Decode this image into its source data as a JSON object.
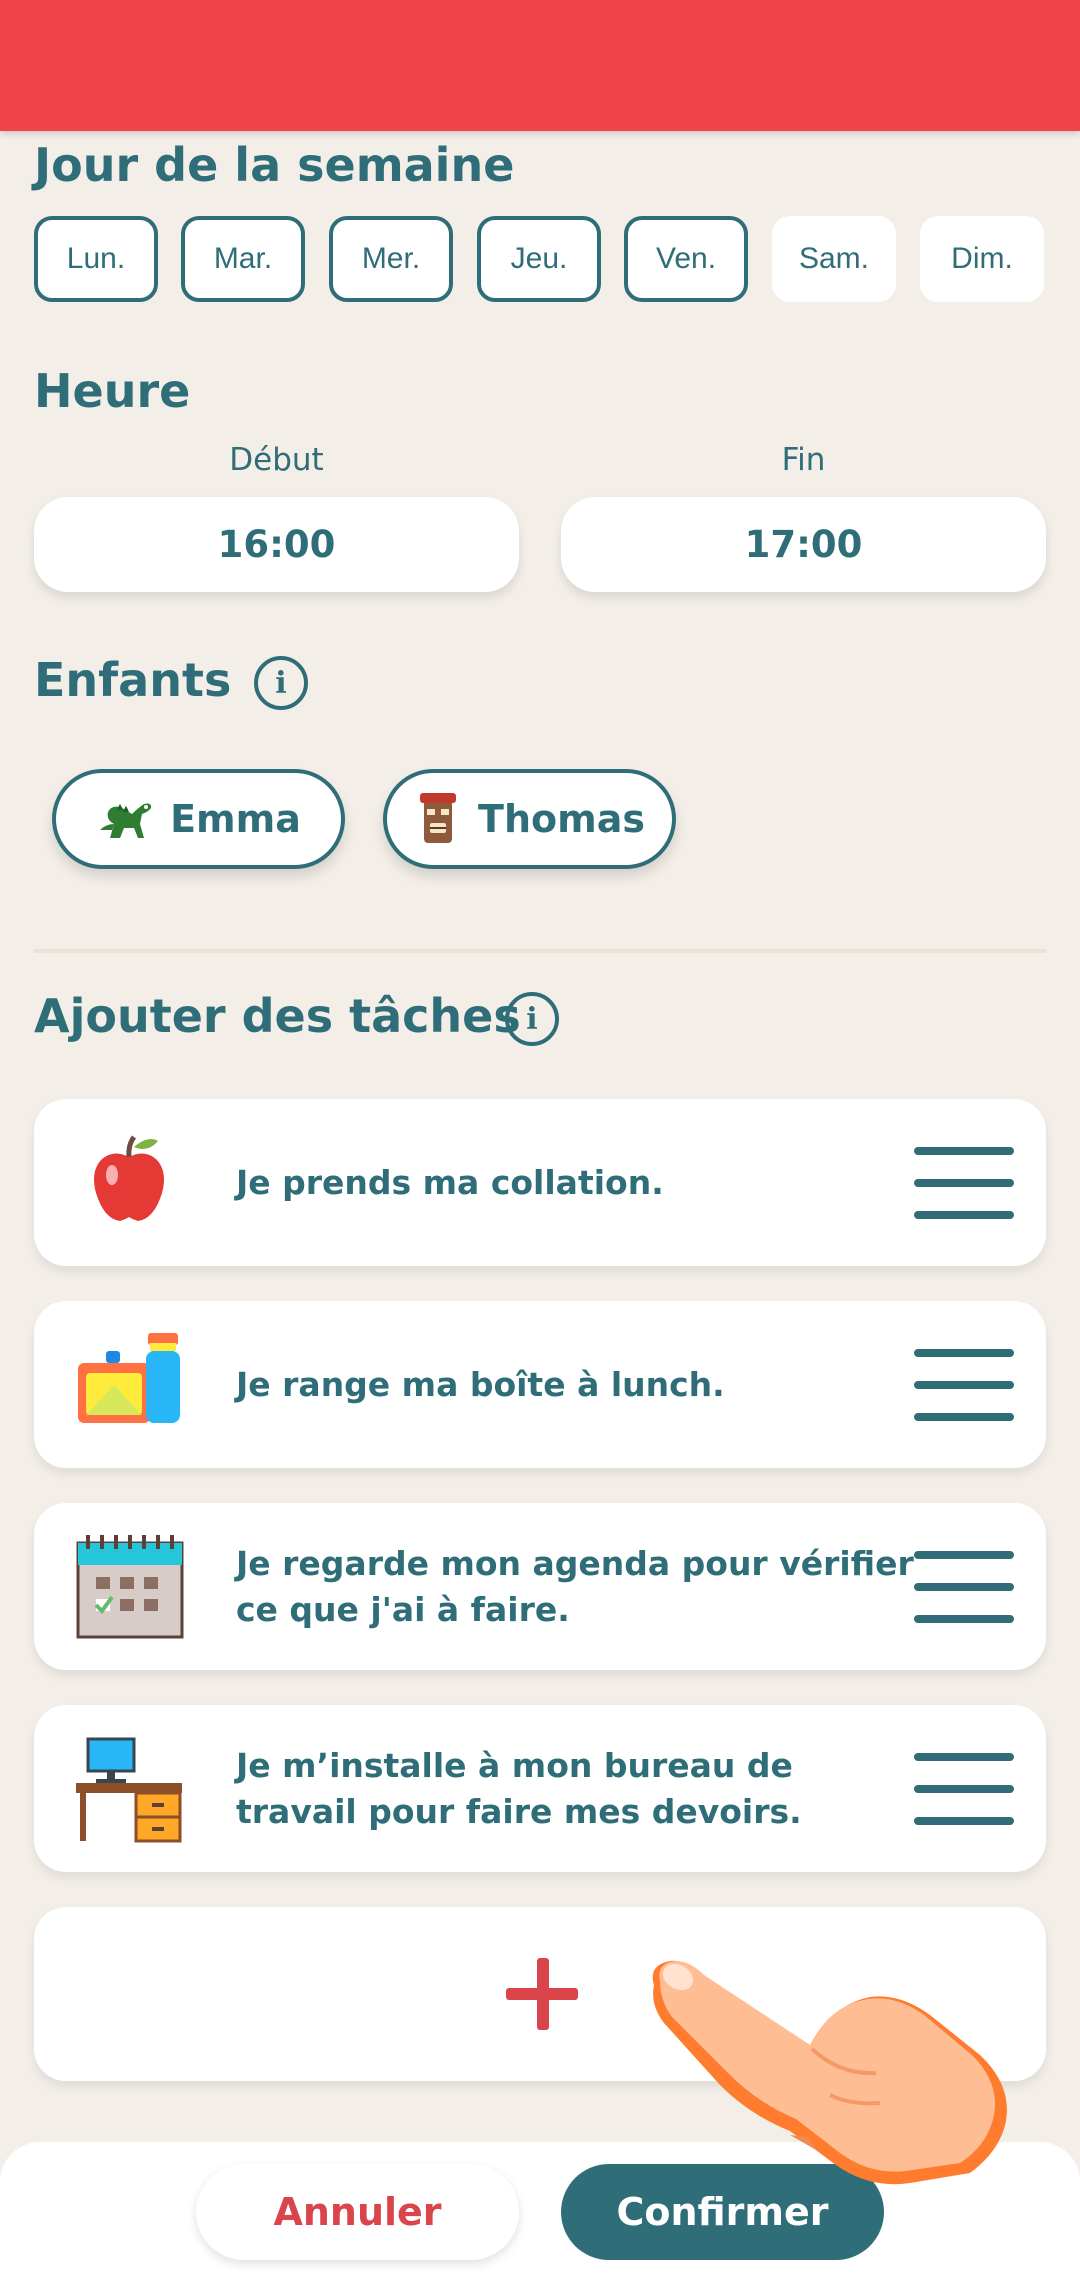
{
  "sections": {
    "days_title": "Jour de la semaine",
    "time_title": "Heure",
    "children_title": "Enfants",
    "tasks_title": "Ajouter des tâches"
  },
  "days": [
    {
      "label": "Lun.",
      "selected": true
    },
    {
      "label": "Mar.",
      "selected": true
    },
    {
      "label": "Mer.",
      "selected": true
    },
    {
      "label": "Jeu.",
      "selected": true
    },
    {
      "label": "Ven.",
      "selected": true
    },
    {
      "label": "Sam.",
      "selected": false
    },
    {
      "label": "Dim.",
      "selected": false
    }
  ],
  "time": {
    "start_label": "Début",
    "end_label": "Fin",
    "start": "16:00",
    "end": "17:00"
  },
  "info_glyph": "i",
  "children": [
    {
      "name": "Emma",
      "icon": "dinosaur-icon"
    },
    {
      "name": "Thomas",
      "icon": "tiki-mask-icon"
    }
  ],
  "tasks": [
    {
      "text": "Je prends ma collation.",
      "icon": "apple-icon"
    },
    {
      "text": "Je range ma boîte à lunch.",
      "icon": "lunchbox-icon"
    },
    {
      "text": "Je regarde mon agenda pour vérifier ce que j'ai à faire.",
      "icon": "calendar-icon"
    },
    {
      "text": "Je m’installe à mon bureau de travail pour faire mes devoirs.",
      "icon": "desk-icon"
    }
  ],
  "add_task_icon": "plus-icon",
  "buttons": {
    "cancel": "Annuler",
    "confirm": "Confirmer"
  },
  "colors": {
    "header": "#F04348",
    "primary": "#2F6E78",
    "accent": "#D9454A",
    "background": "#F3EEE8"
  }
}
